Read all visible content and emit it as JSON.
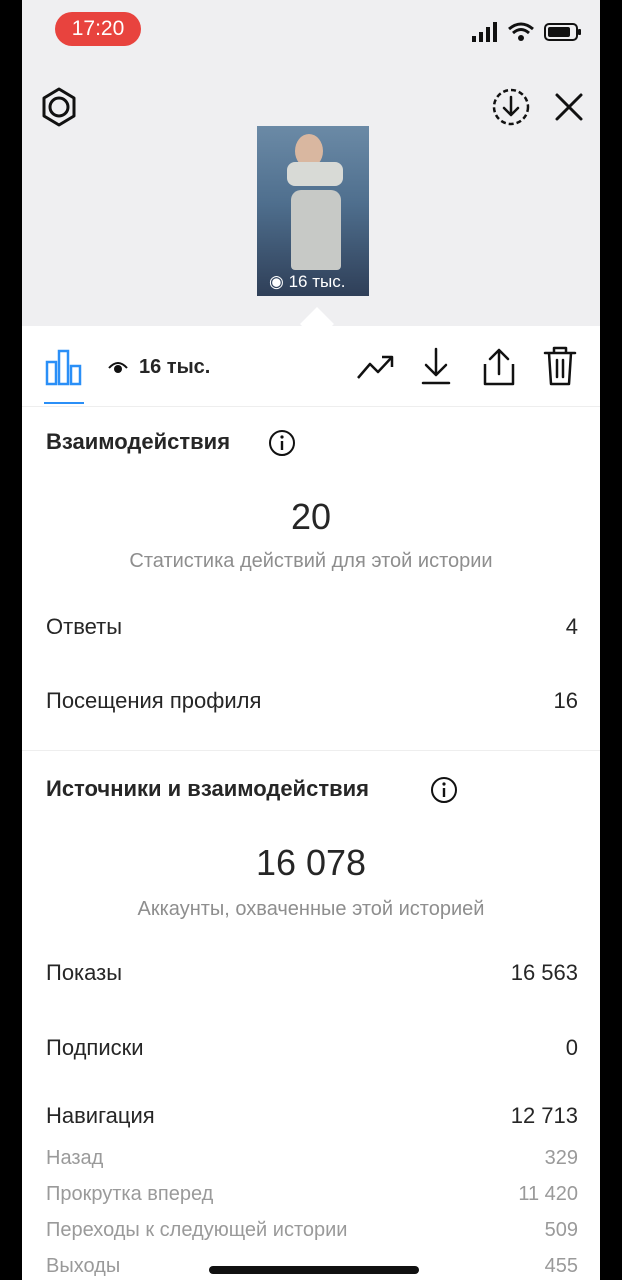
{
  "status_bar": {
    "time": "17:20"
  },
  "story": {
    "views_short": "16 тыс."
  },
  "toolbar": {
    "views": "16 тыс."
  },
  "interactions": {
    "title": "Взаимодействия",
    "total": "20",
    "subtitle": "Статистика действий для этой истории",
    "rows": [
      {
        "label": "Ответы",
        "value": "4"
      },
      {
        "label": "Посещения профиля",
        "value": "16"
      }
    ]
  },
  "discovery": {
    "title": "Источники и взаимодействия",
    "total": "16 078",
    "subtitle": "Аккаунты, охваченные этой историей",
    "rows": [
      {
        "label": "Показы",
        "value": "16 563"
      },
      {
        "label": "Подписки",
        "value": "0"
      },
      {
        "label": "Навигация",
        "value": "12 713"
      }
    ],
    "navigation_details": [
      {
        "label": "Назад",
        "value": "329"
      },
      {
        "label": "Прокрутка вперед",
        "value": "11 420"
      },
      {
        "label": "Переходы к следующей истории",
        "value": "509"
      },
      {
        "label": "Выходы",
        "value": "455"
      }
    ]
  },
  "icons": {
    "settings": "gear-icon",
    "save": "download-circle-icon",
    "close": "close-icon",
    "insights_tab": "bar-chart-icon",
    "views": "eye-icon",
    "promote": "trend-up-icon",
    "download": "download-icon",
    "share": "share-icon",
    "delete": "trash-icon"
  },
  "colors": {
    "time_pill": "#e8433e",
    "accent": "#2a8ff7"
  }
}
